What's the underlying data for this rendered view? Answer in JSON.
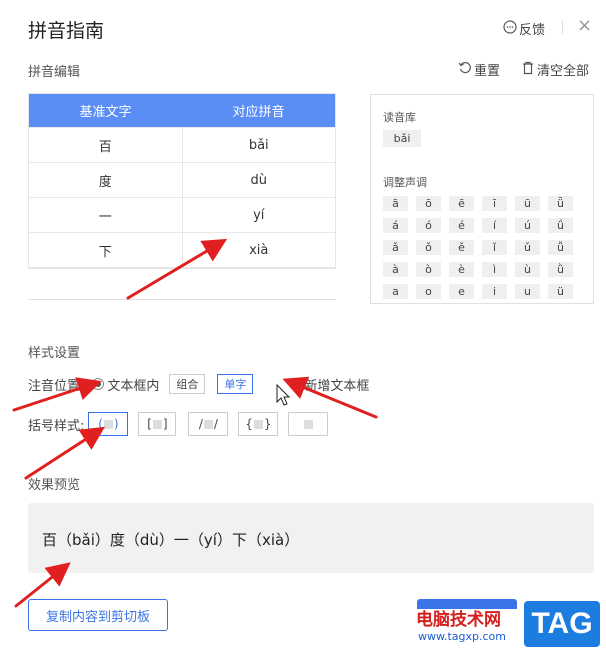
{
  "dialog": {
    "title": "拼音指南",
    "feedback_label": "反馈",
    "close_symbol": "×"
  },
  "editor": {
    "section_label": "拼音编辑",
    "reset_label": "重置",
    "clear_label": "清空全部",
    "columns": [
      "基准文字",
      "对应拼音"
    ],
    "rows": [
      {
        "text": "百",
        "pinyin": "bǎi"
      },
      {
        "text": "度",
        "pinyin": "dù"
      },
      {
        "text": "一",
        "pinyin": "yí"
      },
      {
        "text": "下",
        "pinyin": "xià"
      }
    ]
  },
  "library": {
    "label": "读音库",
    "reading": "bǎi",
    "tone_label": "调整声调",
    "tones": [
      [
        "ā",
        "ō",
        "ē",
        "ī",
        "ū",
        "ǖ"
      ],
      [
        "á",
        "ó",
        "é",
        "í",
        "ú",
        "ǘ"
      ],
      [
        "ǎ",
        "ǒ",
        "ě",
        "ǐ",
        "ǔ",
        "ǚ"
      ],
      [
        "à",
        "ò",
        "è",
        "ì",
        "ù",
        "ǜ"
      ],
      [
        "a",
        "o",
        "e",
        "i",
        "u",
        "ü"
      ]
    ]
  },
  "style": {
    "section_label": "样式设置",
    "position_label": "注音位置:",
    "option_inline": "文本框内",
    "combine_label": "组合",
    "single_label": "单字",
    "option_new_box": "新增文本框",
    "bracket_label": "括号样式:",
    "brackets": [
      {
        "left": "(",
        "right": ")"
      },
      {
        "left": "[",
        "right": "]"
      },
      {
        "left": "/",
        "right": "/"
      },
      {
        "left": "{",
        "right": "}"
      },
      {
        "left": "",
        "right": ""
      }
    ]
  },
  "preview": {
    "section_label": "效果预览",
    "text": "百（bǎi）度（dù）一（yí）下（xià）"
  },
  "copy_button_label": "复制内容到剪切板",
  "watermark": {
    "site_name": "电脑技术网",
    "url": "www.tagxp.com",
    "tag": "TAG"
  },
  "colors": {
    "accent": "#3b73e8",
    "table_header": "#5b8ef5",
    "arrow": "#e02020"
  }
}
